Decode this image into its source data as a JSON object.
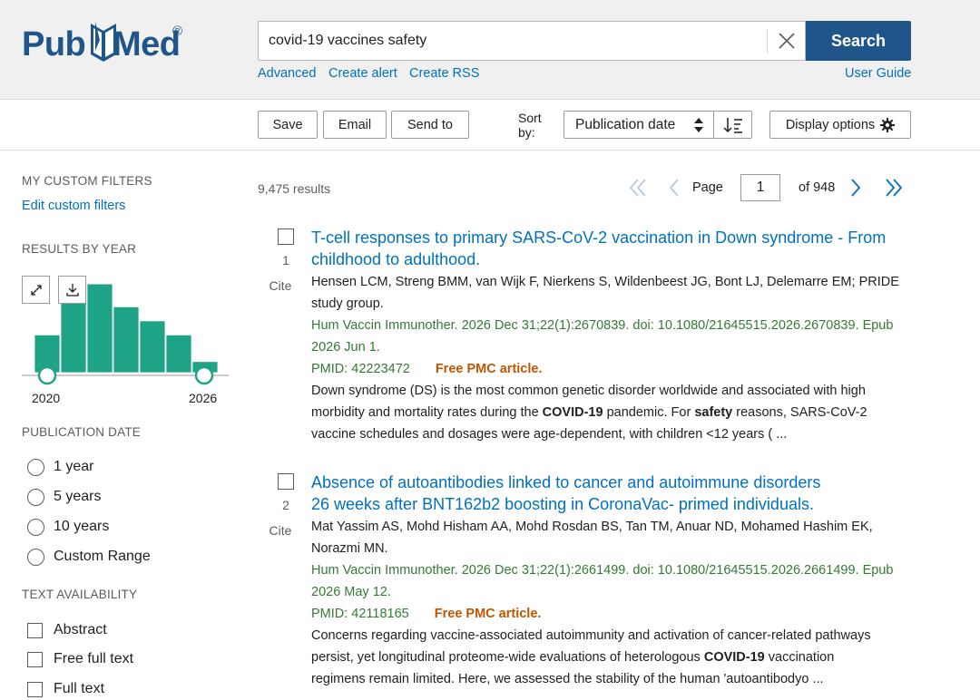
{
  "logo": {
    "pub": "Pub",
    "med": "Med",
    "reg": "®"
  },
  "search": {
    "value": "covid-19 vaccines safety",
    "button": "Search"
  },
  "header_links": {
    "advanced": "Advanced",
    "create_alert": "Create alert",
    "create_rss": "Create RSS",
    "user_guide": "User Guide"
  },
  "actions": {
    "save": "Save",
    "email": "Email",
    "send_to": "Send to",
    "sort_label_1": "Sort",
    "sort_label_2": "by:",
    "sort_value": "Publication date",
    "display_options": "Display options"
  },
  "sidebar": {
    "custom_filters_heading": "MY CUSTOM FILTERS",
    "edit_custom_filters": "Edit custom filters",
    "results_by_year_heading": "RESULTS BY YEAR",
    "year_start": "2020",
    "year_end": "2026",
    "publication_date_heading": "PUBLICATION DATE",
    "date_options": [
      "1 year",
      "5 years",
      "10 years",
      "Custom Range"
    ],
    "text_availability_heading": "TEXT AVAILABILITY",
    "text_options": [
      "Abstract",
      "Free full text",
      "Full text"
    ]
  },
  "chart_data": {
    "type": "bar",
    "categories": [
      "2020",
      "2021",
      "2022",
      "2023",
      "2024",
      "2025",
      "2026"
    ],
    "values": [
      1020,
      1940,
      2400,
      1780,
      1400,
      1020,
      300
    ],
    "xlabel": "",
    "ylabel": "",
    "ylim": [
      0,
      2500
    ],
    "bar_color": "#1fa386"
  },
  "results": {
    "count": "9,475 results",
    "page_label": "Page",
    "page_value": "1",
    "page_of": "of 948",
    "items": [
      {
        "num": "1",
        "cite": "Cite",
        "title_1": "T-cell responses to primary SARS-CoV-2 vaccination in Down syndrome - From",
        "title_2": "childhood to adulthood.",
        "authors_1": "Hensen LCM, Streng BMM, van Wijk F, Nierkens S, Wildenbeest JG, Bont LJ, Delemarre EM; PRIDE",
        "authors_2": "study group.",
        "journal_1": "Hum Vaccin Immunother. 2026 Dec 31;22(1):2670839. doi: 10.1080/21645515.2026.2670839. Epub",
        "journal_2": "2026 Jun 1.",
        "pmid": "PMID: 42223472",
        "free": "Free PMC article.",
        "snippet_1": "Down syndrome (DS) is the most common genetic disorder worldwide and associated with high",
        "snippet_2a": "morbidity and mortality rates during the ",
        "snippet_2b": "COVID-19",
        "snippet_2c": " pandemic. For ",
        "snippet_2d": "safety",
        "snippet_2e": " reasons, SARS-CoV-2",
        "snippet_3": "vaccine schedules and dosages were age-dependent, with children <12 years ( ..."
      },
      {
        "num": "2",
        "cite": "Cite",
        "title_1": "Absence of autoantibodies linked to cancer and autoimmune disorders",
        "title_2": "26 weeks after BNT162b2 boosting in CoronaVac- primed individuals.",
        "authors_1": "Mat Yassim AS, Mohd Hisham AA, Mohd Rosdan BS, Tan TM, Anuar ND, Mohamed Hashim EK,",
        "authors_2": "Norazmi MN.",
        "journal_1": "Hum Vaccin Immunother. 2026 Dec 31;22(1):2661499. doi: 10.1080/21645515.2026.2661499. Epub",
        "journal_2": "2026 May 12.",
        "pmid": "PMID: 42118165",
        "free": "Free PMC article.",
        "snippet_1": "Concerns regarding vaccine-associated autoimmunity and activation of cancer-related pathways",
        "snippet_2a": "persist, yet longitudinal proteome-wide evaluations of heterologous ",
        "snippet_2b": "COVID-19",
        "snippet_2c": " vaccination",
        "snippet_3": "regimens remain limited. Here, we assessed the stability of the human 'autoantibodyo ..."
      }
    ]
  }
}
